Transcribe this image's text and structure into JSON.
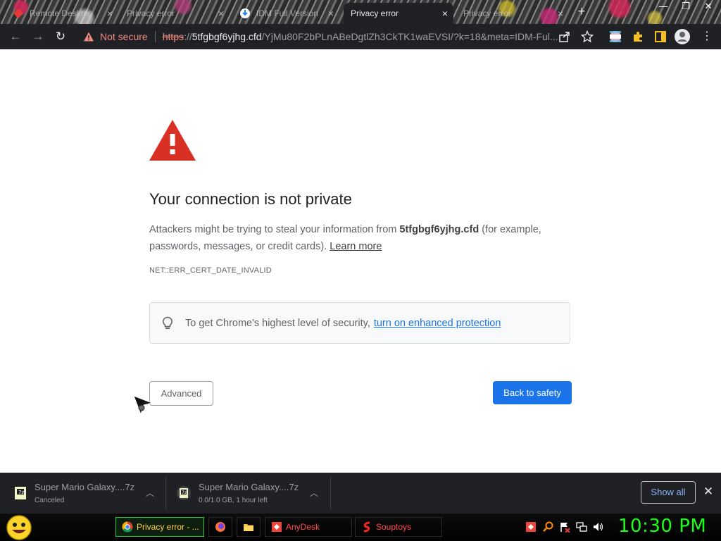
{
  "browser": {
    "tabs": [
      {
        "title": "Remote Desktop",
        "active": false
      },
      {
        "title": "Privacy error",
        "active": false
      },
      {
        "title": "IDM Full Version",
        "active": false
      },
      {
        "title": "Privacy error",
        "active": true
      },
      {
        "title": "Privacy error",
        "active": false
      }
    ],
    "new_tab_symbol": "+",
    "window_controls": {
      "minimize": "—",
      "restore": "❐",
      "close": "✕"
    },
    "tab_close_symbol": "×"
  },
  "toolbar": {
    "security_label": "Not secure",
    "url_scheme": "https",
    "url_separator": "://",
    "url_host": "5tfgbgf6yjhg.cfd",
    "url_path": "/YjMu80F2bPLnABeDgtlZh3CkTK1waEVSI/?k=18&meta=IDM-Ful..."
  },
  "page": {
    "heading": "Your connection is not private",
    "desc_before": "Attackers might be trying to steal your information from ",
    "desc_host": "5tfgbgf6yjhg.cfd",
    "desc_after": " (for example, passwords, messages, or credit cards). ",
    "learn_more": "Learn more",
    "error_code": "NET::ERR_CERT_DATE_INVALID",
    "enhanced_text": "To get Chrome's highest level of security,",
    "enhanced_link": "turn on enhanced protection",
    "advanced_label": "Advanced",
    "safety_label": "Back to safety"
  },
  "downloads": {
    "items": [
      {
        "name": "Super Mario Galaxy....7z",
        "status": "Canceled"
      },
      {
        "name": "Super Mario Galaxy....7z",
        "status": "0.0/1.0 GB, 1 hour left"
      }
    ],
    "show_all": "Show all",
    "close_symbol": "✕"
  },
  "taskbar": {
    "tasks": [
      {
        "label": "Privacy error - ...",
        "icon": "chrome-icon",
        "active": true
      },
      {
        "label": "",
        "icon": "firefox-icon",
        "active": false
      },
      {
        "label": "",
        "icon": "folder-icon",
        "active": false
      },
      {
        "label": "AnyDesk",
        "icon": "anydesk-icon",
        "active": false
      },
      {
        "label": "Souptoys",
        "icon": "souptoys-icon",
        "active": false
      }
    ],
    "clock": "10:30 PM"
  },
  "colors": {
    "danger": "#d93025",
    "primary_button": "#1a73e8",
    "not_secure_text": "#f28b82",
    "clock": "#1aff1a"
  }
}
